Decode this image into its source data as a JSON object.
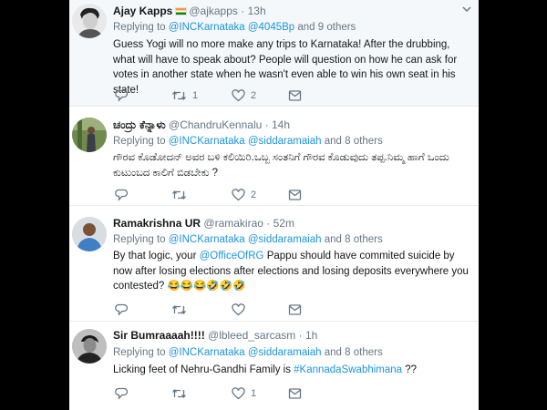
{
  "tweets": [
    {
      "name": "Ajay Kapps",
      "has_flag": true,
      "handle": "@ajkapps",
      "time": "13h",
      "reply_prefix": "Replying to",
      "mentions": "@INCKarnataka @4045Bp",
      "and_others": "and 9 others",
      "text": "Guess Yogi will no more make any trips to Karnataka! After the drubbing, what will have to speak about? People will question on how he can ask for votes in another state when he wasn't even able to win his own seat in his state!",
      "retweets": "1",
      "likes": "2"
    },
    {
      "name": "ಚಂದ್ರು ಕೆನ್ನಾಳು",
      "handle": "@ChandruKennalu",
      "time": "14h",
      "reply_prefix": "Replying to",
      "mentions": "@INCKarnataka @siddaramaiah",
      "and_others": "and 8 others",
      "text": "ಗೌರವ ಕೊಡೋದನ್ ಅವರ ಬಳಿ ಕಲಿಯಿರಿ.ಒಬ್ಬ ಸಂತನಿಗೆ ಗೌರವ ಕೊಡುವುದು ತಪ್ಪ.ನಿಮ್ಮ ಹಾಗೆ ಒಂದು ಕುಟುಂಬದ ಕಾಲಿಗೆ ಬಿಡಬೇಕು ?",
      "retweets": "",
      "likes": "2"
    },
    {
      "name": "Ramakrishna UR",
      "handle": "@ramakirao",
      "time": "52m",
      "reply_prefix": "Replying to",
      "mentions": "@INCKarnataka @siddaramaiah",
      "and_others": "and 8 others",
      "text_pre": "By that logic, your ",
      "text_mention": "@OfficeOfRG",
      "text_post": " Pappu should have commited suicide by now after losing elections after elections and losing deposits everywhere you contested? 😂😂😂🤣🤣🤣",
      "retweets": "",
      "likes": ""
    },
    {
      "name": "Sir Bumraaaah!!!!",
      "handle": "@lbleed_sarcasm",
      "time": "1h",
      "reply_prefix": "Replying to",
      "mentions": "@INCKarnataka @siddaramaiah",
      "and_others": "and 8 others",
      "text_pre": "Licking feet of Nehru-Gandhi Family is ",
      "text_mention": "#KannadaSwabhimana",
      "text_post": " ??",
      "retweets": "",
      "likes": "1"
    }
  ],
  "separator": "·",
  "colors": {
    "link": "#1b95e0",
    "muted": "#657786",
    "text": "#14171a",
    "highlight_bg": "#f5f8fa"
  },
  "icons": [
    "reply-icon",
    "retweet-icon",
    "like-icon",
    "dm-icon",
    "chevron-down-icon",
    "india-flag-icon"
  ]
}
